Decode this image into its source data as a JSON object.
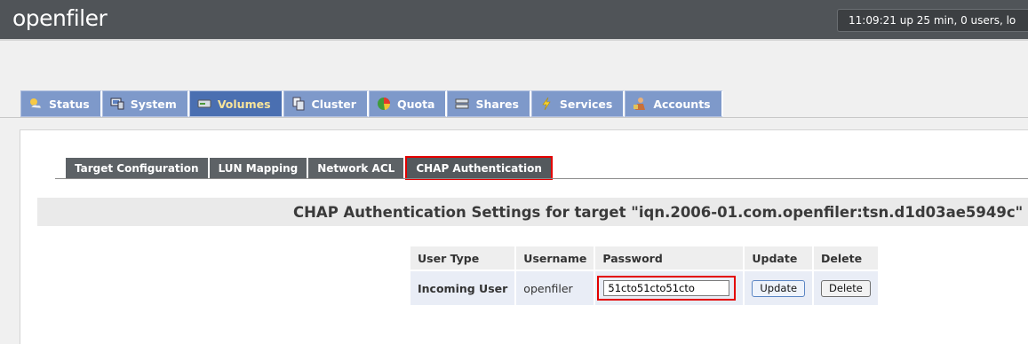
{
  "header": {
    "logo": "openfiler",
    "uptime": "11:09:21 up 25 min, 0 users, lo"
  },
  "main_tabs": [
    {
      "label": "Status",
      "icon": "status-icon"
    },
    {
      "label": "System",
      "icon": "system-icon"
    },
    {
      "label": "Volumes",
      "icon": "volumes-icon",
      "active": true
    },
    {
      "label": "Cluster",
      "icon": "cluster-icon"
    },
    {
      "label": "Quota",
      "icon": "quota-icon"
    },
    {
      "label": "Shares",
      "icon": "shares-icon"
    },
    {
      "label": "Services",
      "icon": "services-icon"
    },
    {
      "label": "Accounts",
      "icon": "accounts-icon"
    }
  ],
  "sub_tabs": [
    {
      "label": "Target Configuration"
    },
    {
      "label": "LUN Mapping"
    },
    {
      "label": "Network ACL"
    },
    {
      "label": "CHAP Authentication",
      "active": true
    }
  ],
  "section": {
    "title": "CHAP Authentication Settings for target \"iqn.2006-01.com.openfiler:tsn.d1d03ae5949c\""
  },
  "table": {
    "headers": [
      "User Type",
      "Username",
      "Password",
      "Update",
      "Delete"
    ],
    "row": {
      "user_type": "Incoming User",
      "username": "openfiler",
      "password": "51cto51cto51cto",
      "update_label": "Update",
      "delete_label": "Delete"
    }
  },
  "colors": {
    "header_bg": "#505458",
    "tab_bg": "#7e99ca",
    "tab_active_bg": "#4a6fb1",
    "subtab_bg": "#5d6266",
    "highlight": "#e30000"
  }
}
